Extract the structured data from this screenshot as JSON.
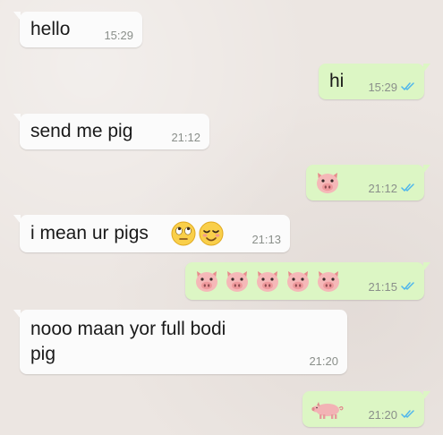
{
  "messages": [
    {
      "direction": "incoming",
      "text": "hello",
      "time": "15:29"
    },
    {
      "direction": "outgoing",
      "text": "hi",
      "time": "15:29",
      "status": "read-double-check"
    },
    {
      "direction": "incoming",
      "text": "send me pig",
      "time": "21:12"
    },
    {
      "direction": "outgoing",
      "emoji": [
        "pig-face"
      ],
      "time": "21:12",
      "status": "read-double-check"
    },
    {
      "direction": "incoming",
      "text": "i mean ur pigs",
      "emoji": [
        "face-with-rolling-eyes",
        "relieved-face"
      ],
      "time": "21:13"
    },
    {
      "direction": "outgoing",
      "emoji": [
        "pig-face",
        "pig-face",
        "pig-face",
        "pig-face",
        "pig-face"
      ],
      "time": "21:15",
      "status": "read-double-check"
    },
    {
      "direction": "incoming",
      "text_line1": "nooo maan yor full bodi",
      "text_line2": "pig",
      "time": "21:20"
    },
    {
      "direction": "outgoing",
      "emoji": [
        "pig"
      ],
      "time": "21:20",
      "status": "read-double-check"
    }
  ],
  "colors": {
    "background": "#ece6e2",
    "incoming_bubble": "#fbfbfb",
    "outgoing_bubble": "#dcf6c4",
    "read_ticks": "#4fb6ec",
    "timestamp": "#8a8f8a"
  }
}
